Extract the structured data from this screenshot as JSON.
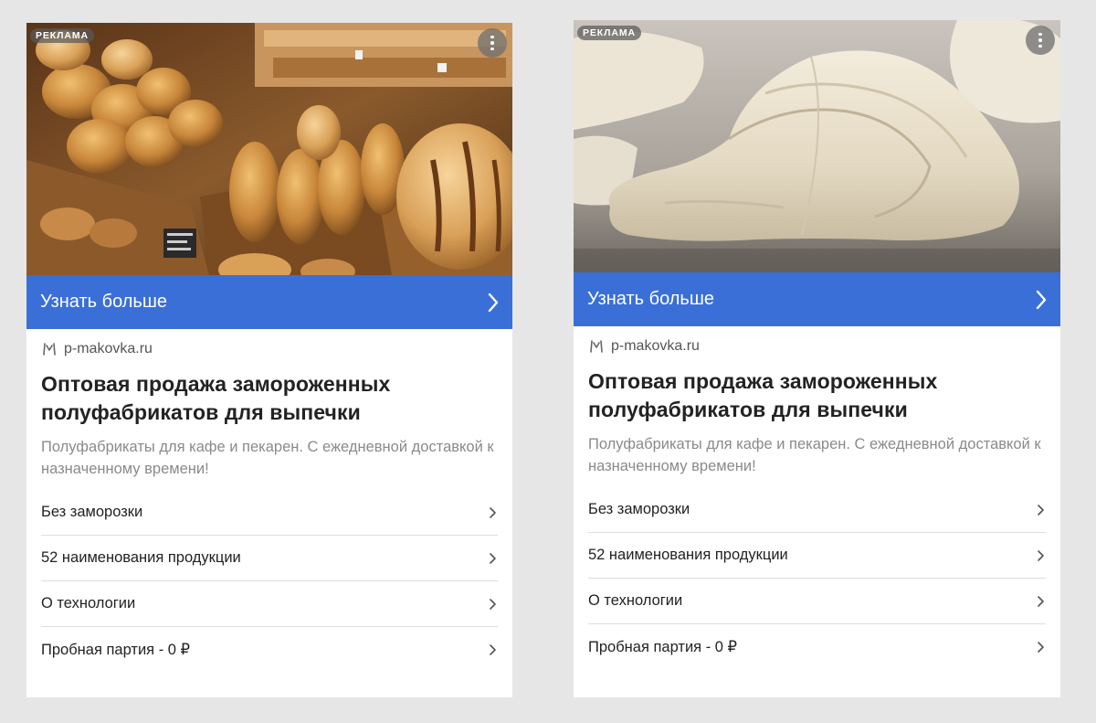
{
  "ads": [
    {
      "badge": "РЕКЛАМА",
      "image_icon": "bread-baskets-photo",
      "cta_label": "Узнать больше",
      "domain": "p-makovka.ru",
      "title": "Оптовая продажа замороженных полуфабрикатов для выпечки",
      "description": "Полуфабрикаты для кафе и пекарен. С ежедневной доставкой к назначенному времени!",
      "links": [
        {
          "label": "Без заморозки"
        },
        {
          "label": "52 наименования продукции"
        },
        {
          "label": "О технологии"
        },
        {
          "label": "Пробная партия - 0 ₽"
        }
      ]
    },
    {
      "badge": "РЕКЛАМА",
      "image_icon": "croissant-dough-photo",
      "cta_label": "Узнать больше",
      "domain": "p-makovka.ru",
      "title": "Оптовая продажа замороженных полуфабрикатов для выпечки",
      "description": "Полуфабрикаты для кафе и пекарен. С ежедневной доставкой к назначенному времени!",
      "links": [
        {
          "label": "Без заморозки"
        },
        {
          "label": "52 наименования продукции"
        },
        {
          "label": "О технологии"
        },
        {
          "label": "Пробная партия - 0 ₽"
        }
      ]
    }
  ],
  "colors": {
    "page_background": "#e6e6e6",
    "cta_blue": "#3a6fd8",
    "title_text": "#222222",
    "description_text": "#8a8a8a"
  }
}
